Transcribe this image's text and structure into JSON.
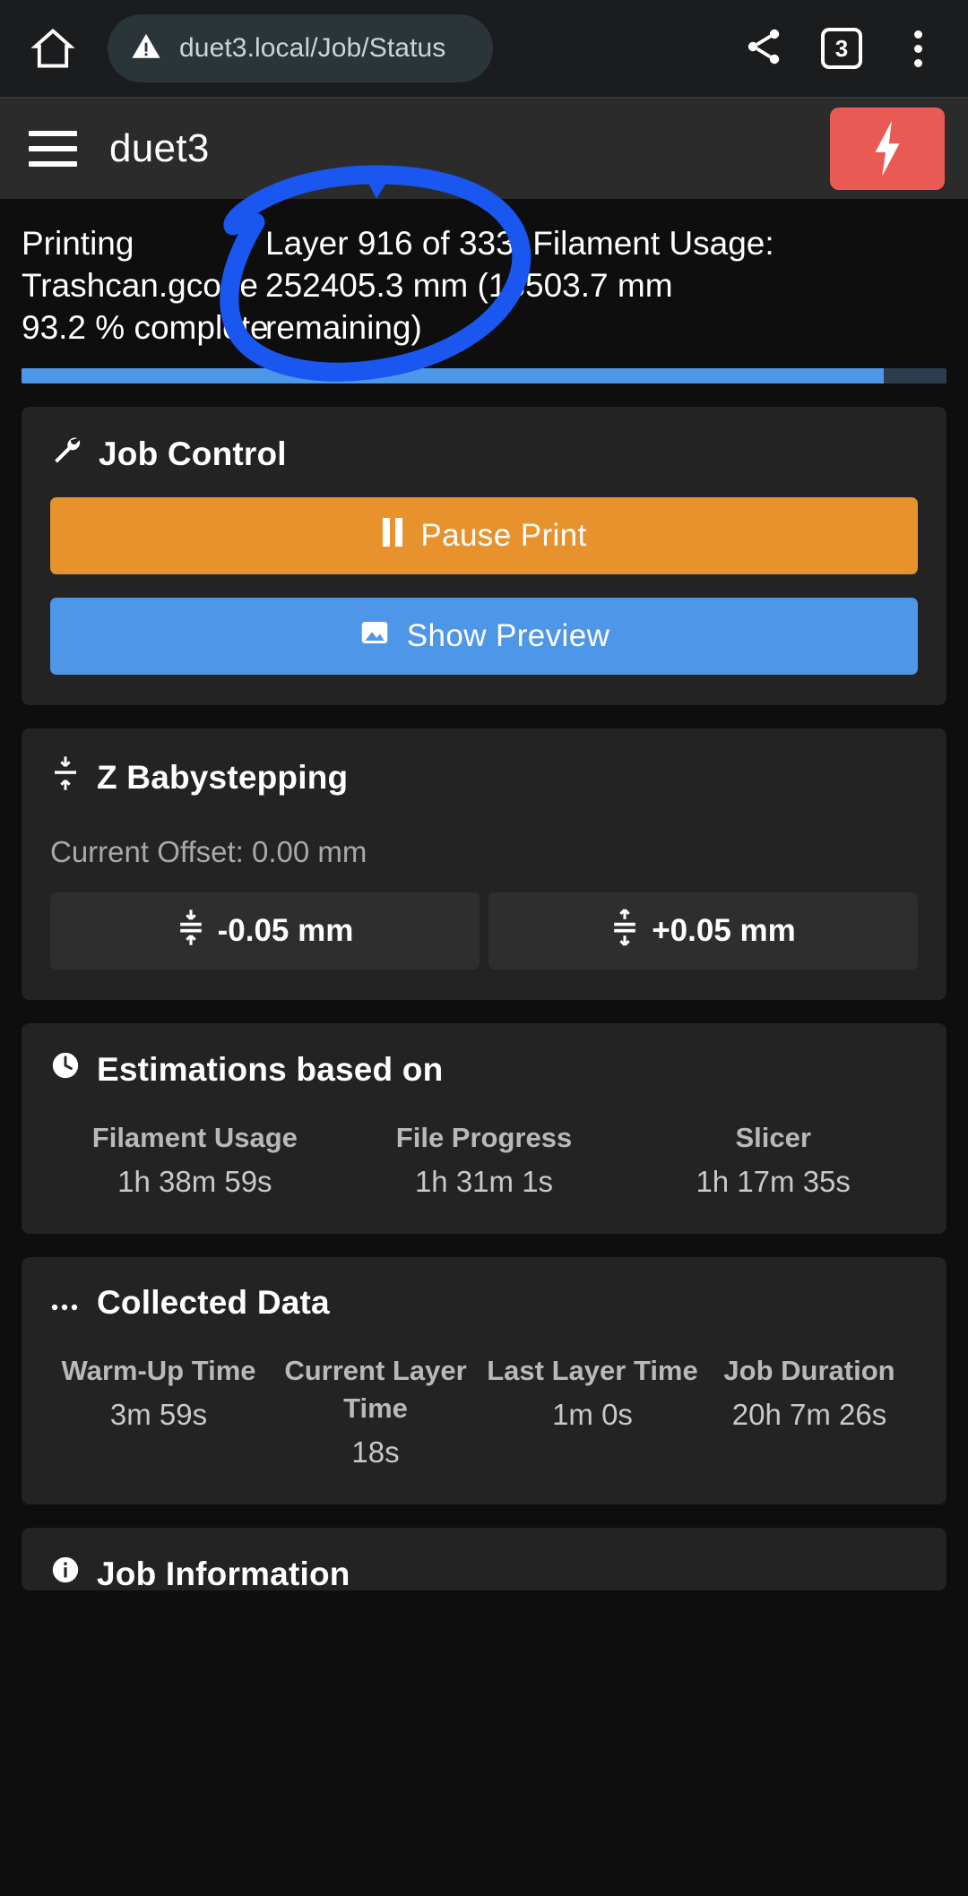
{
  "browser": {
    "url": "duet3.local/Job/Status",
    "tab_count": "3",
    "home_icon": "home-icon",
    "warning_icon": "insecure-warning-icon",
    "share_icon": "share-icon",
    "menu_icon": "overflow-menu-icon"
  },
  "appbar": {
    "menu_icon": "hamburger-menu-icon",
    "title": "duet3",
    "emergency_icon": "lightning-bolt-icon"
  },
  "status": {
    "left": [
      "Printing",
      "Trashcan.gcode",
      "93.2 % complete"
    ],
    "right": [
      "Layer 916 of 333, Filament Usage:",
      "252405.3 mm (18503.7 mm",
      "remaining)"
    ],
    "progress_percent": 93.2,
    "progress_color": "#4e96e8",
    "progress_track_color": "#2c3d4e"
  },
  "job_control": {
    "icon": "wrench-icon",
    "title": "Job Control",
    "pause_label": "Pause Print",
    "pause_icon": "pause-icon",
    "pause_color": "#e8922e",
    "preview_label": "Show Preview",
    "preview_icon": "image-icon",
    "preview_color": "#4e96e8"
  },
  "babystepping": {
    "icon": "z-babystep-icon",
    "title": "Z Babystepping",
    "offset_label": "Current Offset: 0.00 mm",
    "decrease_label": "-0.05 mm",
    "decrease_icon": "arrows-collapse-icon",
    "increase_label": "+0.05 mm",
    "increase_icon": "arrows-expand-icon"
  },
  "estimations": {
    "icon": "clock-icon",
    "title": "Estimations based on",
    "items": [
      {
        "label": "Filament Usage",
        "value": "1h 38m 59s"
      },
      {
        "label": "File Progress",
        "value": "1h 31m 1s"
      },
      {
        "label": "Slicer",
        "value": "1h 17m 35s"
      }
    ]
  },
  "collected_data": {
    "icon": "ellipsis-icon",
    "title": "Collected Data",
    "items": [
      {
        "label": "Warm-Up Time",
        "value": "3m 59s"
      },
      {
        "label": "Current Layer Time",
        "value": "18s"
      },
      {
        "label": "Last Layer Time",
        "value": "1m 0s"
      },
      {
        "label": "Job Duration",
        "value": "20h 7m 26s"
      }
    ]
  },
  "job_information": {
    "icon": "info-icon",
    "title": "Job Information"
  },
  "annotation": {
    "type": "hand-drawn-circle",
    "color": "#1a56f0",
    "target": "Layer 916 of 333 / 252405.3 mm"
  }
}
